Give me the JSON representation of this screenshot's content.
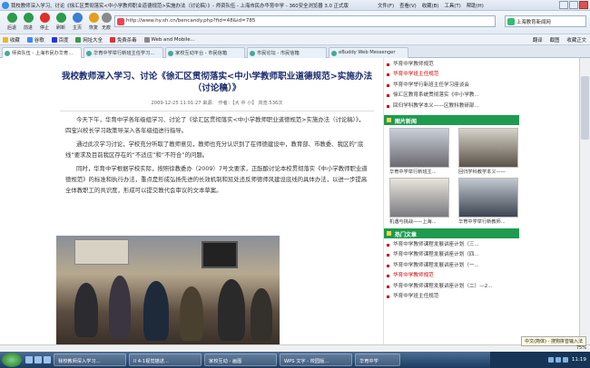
{
  "window": {
    "title": "我校教师深入学习、讨论《徐汇区贯彻落实<中小学教师职业道德规范>实施办法（讨论稿）》- 师资队伍 - 上海市民办华育中学 - 360安全浏览器 3.0 正式版",
    "menus": [
      "文件(F)",
      "查看(V)",
      "收藏(B)",
      "工具(T)",
      "帮助(H)"
    ]
  },
  "toolbar": {
    "buttons": [
      {
        "label": "后退",
        "icon": "back-icon",
        "color": "#2e9a4c"
      },
      {
        "label": "前进",
        "icon": "forward-icon",
        "color": "#2e9a4c"
      },
      {
        "label": "停止",
        "icon": "stop-icon",
        "color": "#d9332b"
      },
      {
        "label": "刷新",
        "icon": "refresh-icon",
        "color": "#2e9a4c"
      },
      {
        "label": "主页",
        "icon": "home-icon",
        "color": "#3a7fd0"
      },
      {
        "label": "恢复",
        "icon": "restore-icon",
        "color": "#e0a020"
      },
      {
        "label": "无痕",
        "icon": "private-icon",
        "color": "#8a8a8a"
      }
    ],
    "address": "http://www.hy.sh.cn/bencandy.php?fid=48&id=785",
    "search_text": "上海教育新闻网"
  },
  "favorites": {
    "items": [
      "收藏",
      "谷歌",
      "百度",
      "网址大全",
      "免费杀毒",
      "Web and Mobile..."
    ],
    "right_items": [
      "翻译",
      "截图",
      "收藏正文"
    ]
  },
  "tabs": [
    "师资队伍 - 上海市民办华育...",
    "华育中学举行新班主任学习...",
    "家校互动平台 - 市民信箱",
    "市民论坛 - 市民信箱",
    "eBuddy Web Messenger"
  ],
  "article": {
    "title": "我校教师深入学习、讨论《徐汇区贯彻落实<中小学教师职业道德规范>实施办法（讨论稿）》",
    "meta": "2009-12-25 11:01:27  来源：  作者：【大 中 小】 浏览:536次",
    "paragraphs": [
      "今天下午，华育中学各年级组学习、讨论了《徐汇区贯彻落实<中小学教师职业道德规范>实施办法（讨论稿）》，四宝兴校长学习政策导深入各年级组进行指导。",
      "通过此次学习讨论，学校充分听取了教师意见，教师也充分认识到了在师德建设中，教育部、市教委、我区的“底线”要求及目前我区存在的“不适应”和“不符合”的问题。",
      "同时，华育中学根据学校实际，按照徐教委办（2009）7号文要求，正酝酿讨论本校贯彻落实《中小学教师职业道德规范》的标准和执行办法，重点是形成弘扬先进的长效机制和惩处违反师德师风建设底线的具体办法，以进一步提高全体教职工的共识度，形成可以提交教代会审议的文本草案。"
    ]
  },
  "sidebar": {
    "top_list": [
      "华育中学教师规范",
      "华育中学班主任规范",
      "华育中学举行新班主任学习座谈会",
      "徐汇区教育系统贯彻落实《中小学教...",
      "回归学科教学本义——区教科教研部..."
    ],
    "top_list_red_index": 1,
    "photo_header": "图片新闻",
    "photos": [
      "华育中学举行新班主...",
      "回归学科教学本义——",
      "机遇与挑战——上海...",
      "华育中学举行新教师..."
    ],
    "hot_header": "热门文章",
    "hot_list": [
      "华育中学教师课程发展讲座计划（三...",
      "华育中学教师课程发展讲座计划（四...",
      "华育中学教师课程发展讲座计划（一...",
      "华育中学教师规范",
      "华育中学教师课程发展讲座计划（二）—2...",
      "华育中学班主任规范"
    ],
    "hot_red_index": 3
  },
  "statusbar": {
    "ime": "中文(简体) - 搜狗拼音输入法",
    "zoom": "75%"
  },
  "taskbar": {
    "items": [
      "我校教师深入学习...",
      "II 4-1视觉描述...",
      "家校互动 - 画图",
      "WPS 文字 - 校园版...",
      "华育中学"
    ],
    "clock": "11:19"
  }
}
